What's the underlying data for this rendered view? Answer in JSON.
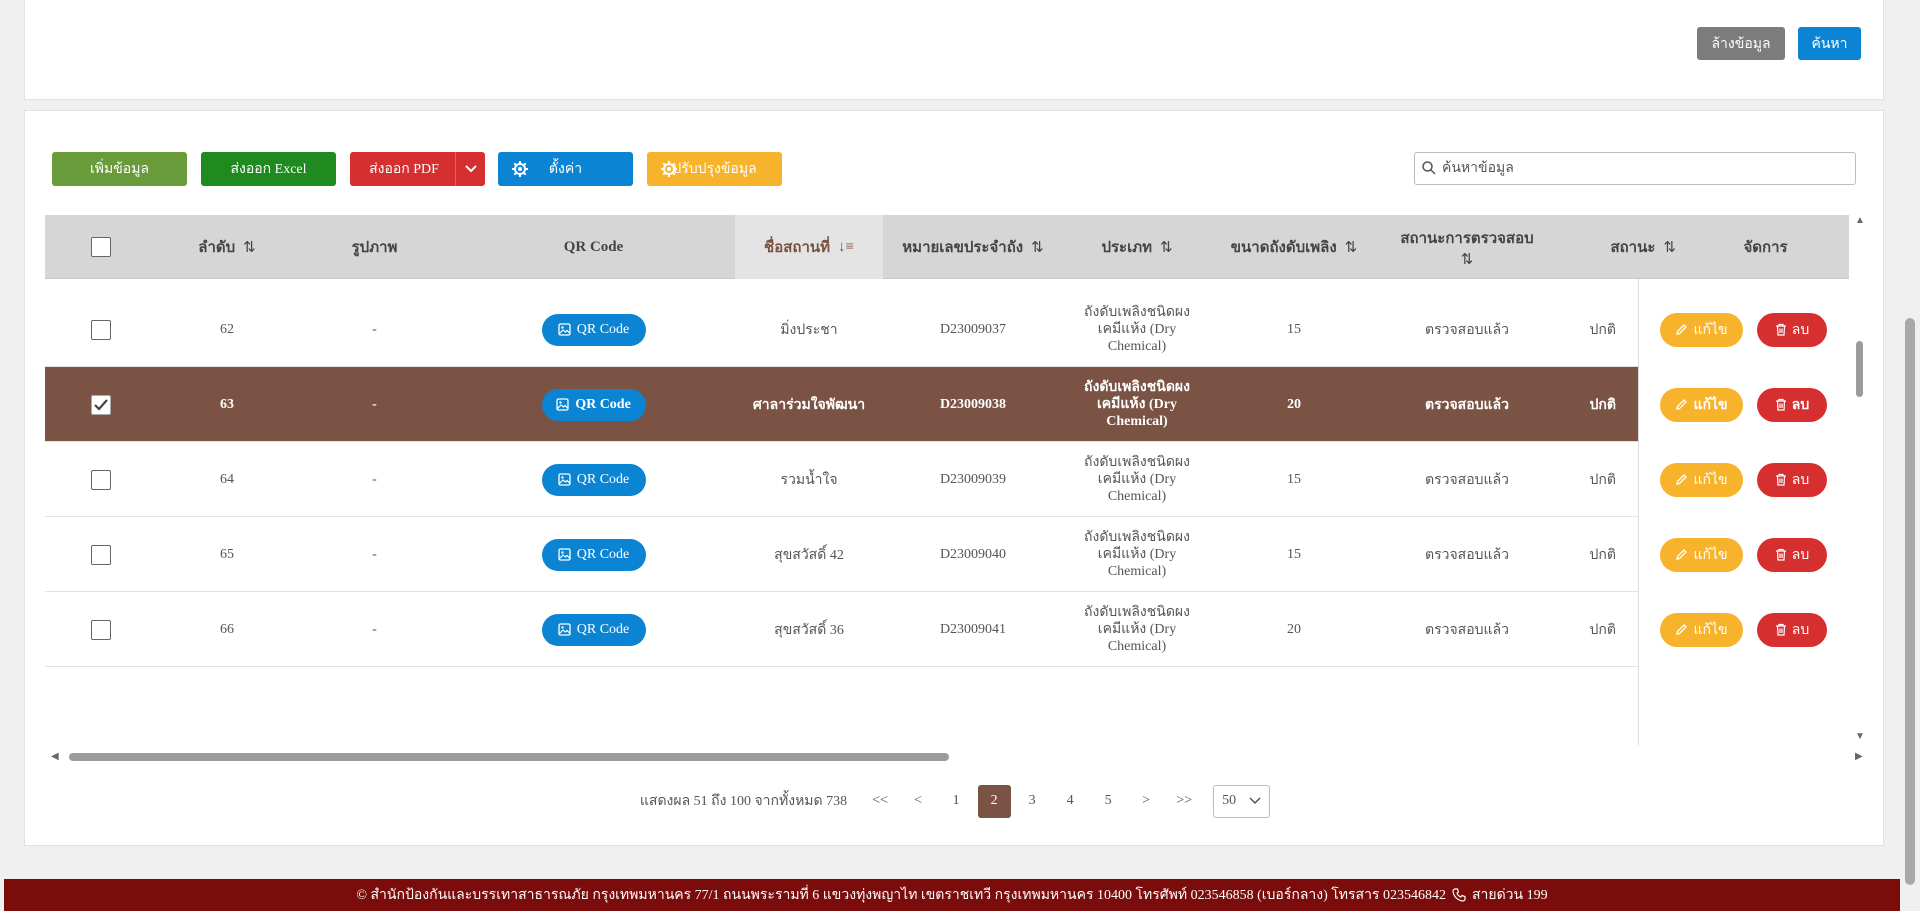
{
  "search_panel": {
    "clear_label": "ล้างข้อมูล",
    "search_label": "ค้นหา"
  },
  "toolbar": {
    "add_label": "เพิ่มข้อมูล",
    "excel_label": "ส่งออก Excel",
    "pdf_label": "ส่งออก PDF",
    "settings_label": "ตั้งค่า",
    "update_label": "ปรับปรุงข้อมูล",
    "search_placeholder": "ค้นหาข้อมูล"
  },
  "table": {
    "headers": {
      "order": "ลำดับ",
      "image": "รูปภาพ",
      "qr": "QR Code",
      "place": "ชื่อสถานที่",
      "tank_no": "หมายเลขประจำถัง",
      "type": "ประเภท",
      "size": "ขนาดถังดับเพลิง",
      "inspect": "สถานะการตรวจสอบ",
      "status": "สถานะ",
      "manage": "จัดการ"
    },
    "qr_label": "QR Code",
    "edit_label": "แก้ไข",
    "delete_label": "ลบ",
    "rows": [
      {
        "no": "62",
        "image": "-",
        "place": "มิ่งประชา",
        "tank_no": "D23009037",
        "type_l1": "ถังดับเพลิงชนิดผง",
        "type_l2": "เคมีแห้ง (Dry",
        "type_l3": "Chemical)",
        "size": "15",
        "inspect": "ตรวจสอบแล้ว",
        "status": "ปกติ",
        "checked": false
      },
      {
        "no": "63",
        "image": "-",
        "place": "ศาลาร่วมใจพัฒนา",
        "tank_no": "D23009038",
        "type_l1": "ถังดับเพลิงชนิดผง",
        "type_l2": "เคมีแห้ง (Dry",
        "type_l3": "Chemical)",
        "size": "20",
        "inspect": "ตรวจสอบแล้ว",
        "status": "ปกติ",
        "checked": true
      },
      {
        "no": "64",
        "image": "-",
        "place": "รวมน้ำใจ",
        "tank_no": "D23009039",
        "type_l1": "ถังดับเพลิงชนิดผง",
        "type_l2": "เคมีแห้ง (Dry",
        "type_l3": "Chemical)",
        "size": "15",
        "inspect": "ตรวจสอบแล้ว",
        "status": "ปกติ",
        "checked": false
      },
      {
        "no": "65",
        "image": "-",
        "place": "สุขสวัสดิ์ 42",
        "tank_no": "D23009040",
        "type_l1": "ถังดับเพลิงชนิดผง",
        "type_l2": "เคมีแห้ง (Dry",
        "type_l3": "Chemical)",
        "size": "15",
        "inspect": "ตรวจสอบแล้ว",
        "status": "ปกติ",
        "checked": false
      },
      {
        "no": "66",
        "image": "-",
        "place": "สุขสวัสดิ์ 36",
        "tank_no": "D23009041",
        "type_l1": "ถังดับเพลิงชนิดผง",
        "type_l2": "เคมีแห้ง (Dry",
        "type_l3": "Chemical)",
        "size": "20",
        "inspect": "ตรวจสอบแล้ว",
        "status": "ปกติ",
        "checked": false
      }
    ]
  },
  "pagination": {
    "info": "แสดงผล 51 ถึง 100 จากทั้งหมด 738",
    "first": "<<",
    "prev": "<",
    "pages": [
      "1",
      "2",
      "3",
      "4",
      "5"
    ],
    "current": "2",
    "next": ">",
    "last": ">>",
    "per_page": "50"
  },
  "footer": {
    "text": "© สำนักป้องกันและบรรเทาสาธารณภัย กรุงเทพมหานคร 77/1 ถนนพระรามที่ 6 แขวงทุ่งพญาไท เขตราชเทวี กรุงเทพมหานคร 10400 โทรศัพท์ 023546858 (เบอร์กลาง) โทรสาร 023546842",
    "hotline": "สายด่วน 199"
  },
  "colors": {
    "primary": "#0b85d3",
    "brown": "#7a5344",
    "green": "#6a9b3a",
    "dark_green": "#1f8a1f",
    "red": "#d62f2f",
    "yellow": "#f7b32b",
    "footer": "#7a0c0c"
  }
}
